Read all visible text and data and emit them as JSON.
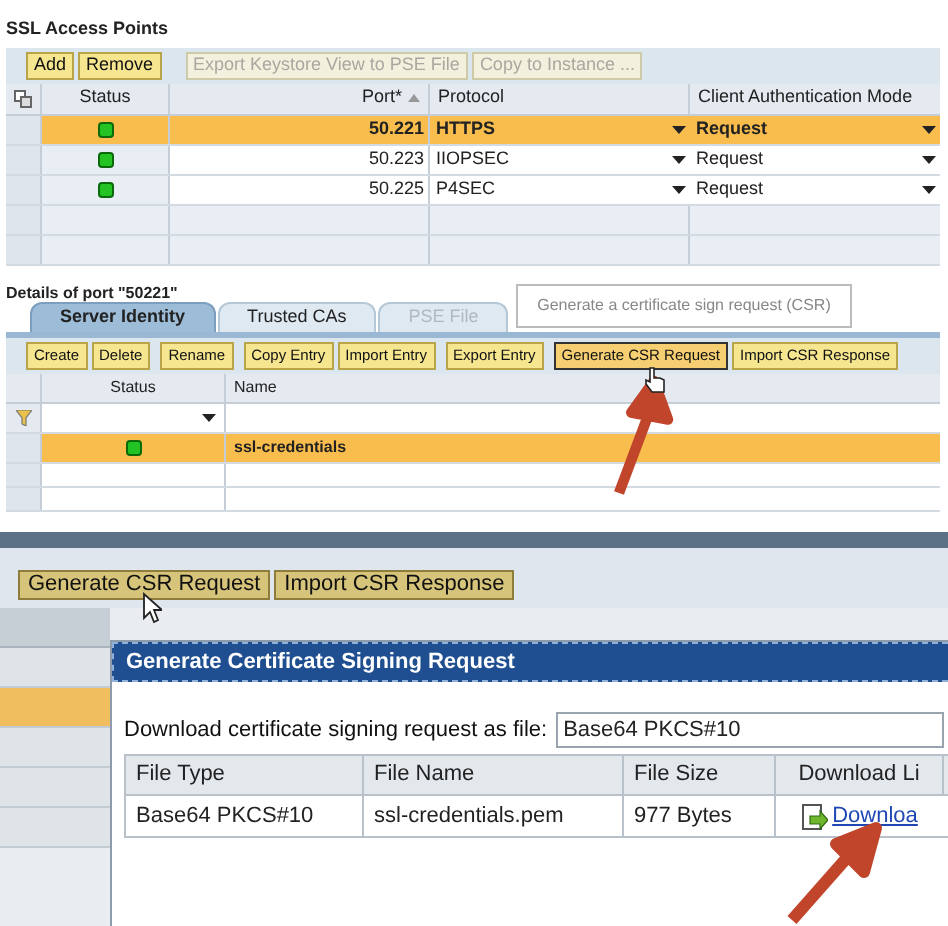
{
  "ssl_access_points": {
    "title": "SSL Access Points",
    "toolbar": [
      {
        "label": "Add",
        "disabled": false
      },
      {
        "label": "Remove",
        "disabled": false
      },
      {
        "label": "Export Keystore View to PSE File",
        "disabled": true
      },
      {
        "label": "Copy to Instance ...",
        "disabled": true
      }
    ],
    "columns": [
      "Status",
      "Port*",
      "Protocol",
      "Client Authentication Mode"
    ],
    "rows": [
      {
        "port": "50.221",
        "protocol": "HTTPS",
        "mode": "Request",
        "selected": true
      },
      {
        "port": "50.223",
        "protocol": "IIOPSEC",
        "mode": "Request",
        "selected": false
      },
      {
        "port": "50.225",
        "protocol": "P4SEC",
        "mode": "Request",
        "selected": false
      }
    ]
  },
  "details": {
    "title": "Details of port \"50221\"",
    "tabs": [
      {
        "label": "Server Identity",
        "selected": true,
        "disabled": false
      },
      {
        "label": "Trusted CAs",
        "selected": false,
        "disabled": false
      },
      {
        "label": "PSE File",
        "selected": false,
        "disabled": true
      }
    ],
    "tooltip": "Generate a certificate sign request (CSR)",
    "toolbar": [
      {
        "label": "Create",
        "pressed": false
      },
      {
        "label": "Delete",
        "pressed": false
      },
      {
        "label": "Rename",
        "pressed": false
      },
      {
        "label": "Copy Entry",
        "pressed": false
      },
      {
        "label": "Import Entry",
        "pressed": false
      },
      {
        "label": "Export Entry",
        "pressed": false
      },
      {
        "label": "Generate CSR Request",
        "pressed": true
      },
      {
        "label": "Import CSR Response",
        "pressed": false
      }
    ],
    "columns": [
      "Status",
      "Name"
    ],
    "rows": [
      {
        "name": "ssl-credentials",
        "selected": true
      }
    ]
  },
  "csr_view": {
    "toolbar": [
      "Generate CSR Request",
      "Import CSR Response"
    ],
    "dialog": {
      "title": "Generate Certificate Signing Request",
      "download_label": "Download certificate signing request as file:",
      "format": "Base64 PKCS#10",
      "columns": [
        "File Type",
        "File Name",
        "File Size",
        "Download Li"
      ],
      "rows": [
        {
          "file_type": "Base64 PKCS#10",
          "file_name": "ssl-credentials.pem",
          "file_size": "977 Bytes",
          "link": "Downloa"
        }
      ]
    }
  }
}
